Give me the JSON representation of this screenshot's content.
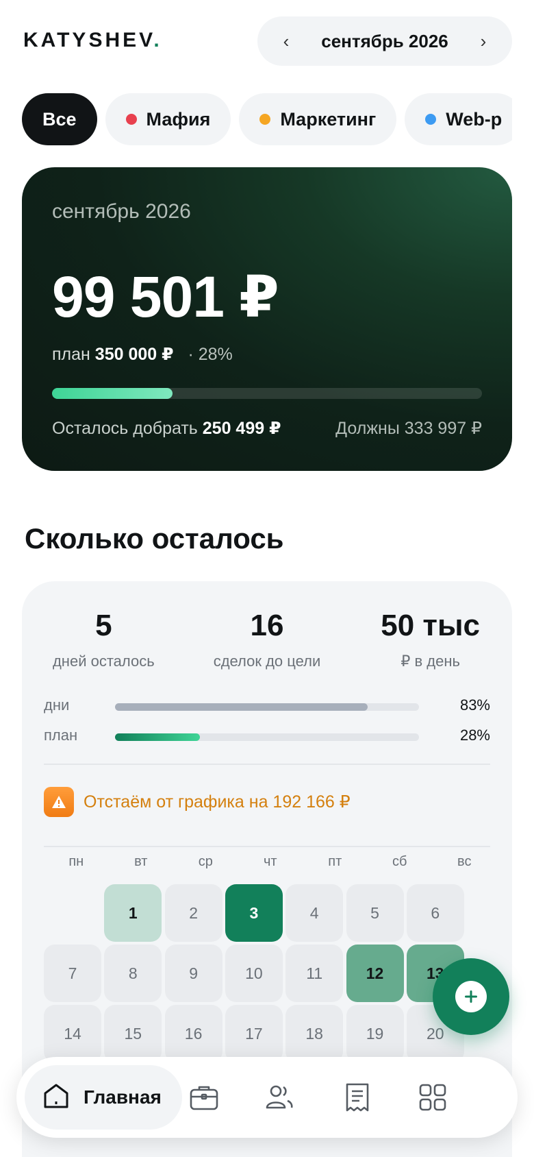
{
  "header": {
    "logo_text": "KATYSHEV",
    "logo_dot": ".",
    "month_label": "сентябрь 2026",
    "prev_icon": "chevron-left-icon",
    "next_icon": "chevron-right-icon",
    "prev_glyph": "‹",
    "next_glyph": "›"
  },
  "chips": [
    {
      "label": "Все",
      "active": true,
      "dot_color": ""
    },
    {
      "label": "Мафия",
      "active": false,
      "dot_color": "#e8404e"
    },
    {
      "label": "Маркетинг",
      "active": false,
      "dot_color": "#f5a623"
    },
    {
      "label": "Web-p",
      "active": false,
      "dot_color": "#3d9bf2"
    }
  ],
  "hero": {
    "month": "сентябрь 2026",
    "amount": "99 501 ₽",
    "plan_prefix": "план",
    "plan_value": "350 000 ₽",
    "plan_percent": "· 28%",
    "progress": 0.28,
    "remain_prefix": "Осталось добрать",
    "remain_value": "250 499 ₽",
    "owe_text": "Должны 333 997 ₽"
  },
  "section_title": "Сколько осталось",
  "remaining": {
    "stats": [
      {
        "value": "5",
        "label": "дней осталось"
      },
      {
        "value": "16",
        "label": "сделок до цели"
      },
      {
        "value": "50 тыс",
        "label": "₽ в день"
      }
    ],
    "progress_rows": [
      {
        "label": "дни",
        "value_text": "83%",
        "fraction": 0.83,
        "color": "#a7afbb"
      },
      {
        "label": "план",
        "value_text": "28%",
        "fraction": 0.28,
        "color": "gradient-green"
      }
    ],
    "warning_icon": "warning-icon",
    "warning_text": "Отстаём от графика на 192 166 ₽"
  },
  "calendar": {
    "weekdays": [
      "пн",
      "вт",
      "ср",
      "чт",
      "пт",
      "сб",
      "вс"
    ],
    "start_offset": 1,
    "days": [
      {
        "day": "1",
        "level": 1
      },
      {
        "day": "2",
        "level": 0
      },
      {
        "day": "3",
        "level": 3
      },
      {
        "day": "4",
        "level": 0
      },
      {
        "day": "5",
        "level": 0
      },
      {
        "day": "6",
        "level": 0
      },
      {
        "day": "7",
        "level": 0
      },
      {
        "day": "8",
        "level": 0
      },
      {
        "day": "9",
        "level": 0
      },
      {
        "day": "10",
        "level": 0
      },
      {
        "day": "11",
        "level": 0
      },
      {
        "day": "12",
        "level": 2
      },
      {
        "day": "13",
        "level": 2
      },
      {
        "day": "14",
        "level": 0
      },
      {
        "day": "15",
        "level": 0
      },
      {
        "day": "16",
        "level": 0
      },
      {
        "day": "17",
        "level": 0
      },
      {
        "day": "18",
        "level": 0
      },
      {
        "day": "19",
        "level": 0
      },
      {
        "day": "20",
        "level": 0
      }
    ]
  },
  "fab": {
    "icon": "plus-icon"
  },
  "nav": {
    "home_label": "Главная",
    "home_icon": "home-icon",
    "items": [
      "briefcase-icon",
      "users-icon",
      "receipt-icon",
      "grid-icon"
    ]
  },
  "colors": {
    "accent": "#12805a",
    "warning": "#d4800f"
  }
}
